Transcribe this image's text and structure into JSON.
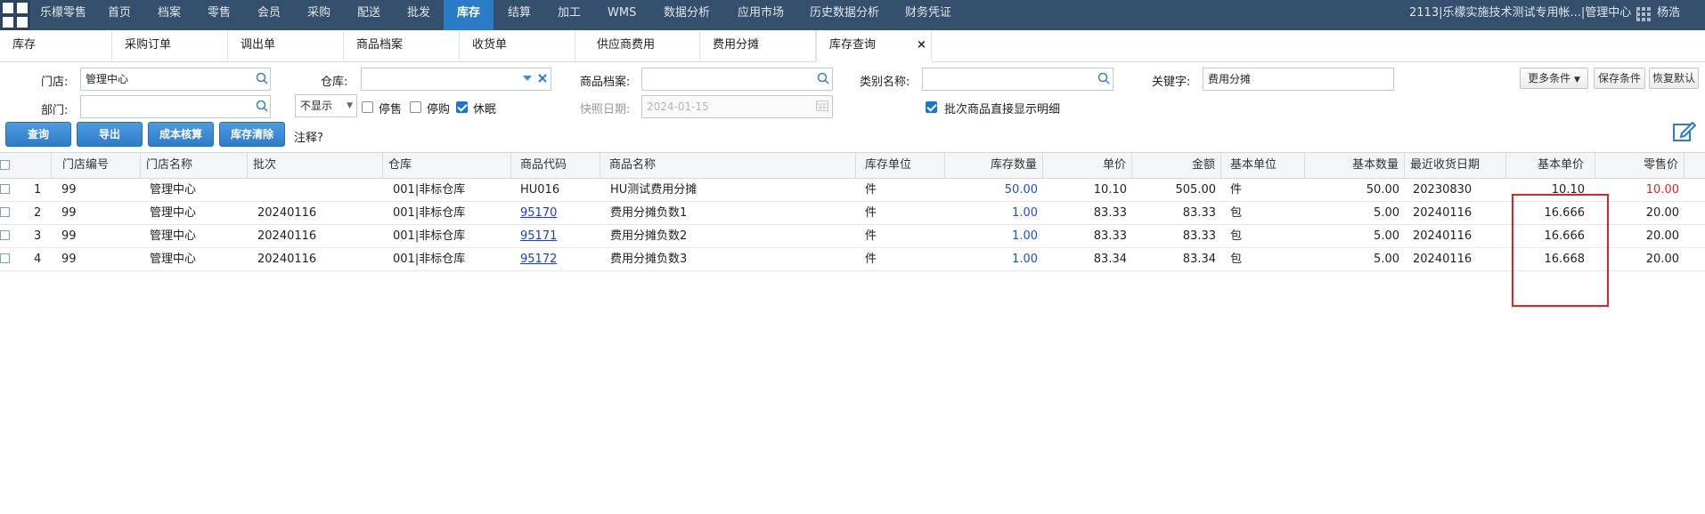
{
  "topnav": {
    "items": [
      {
        "label": "乐檬零售"
      },
      {
        "label": "首页"
      },
      {
        "label": "档案"
      },
      {
        "label": "零售"
      },
      {
        "label": "会员"
      },
      {
        "label": "采购"
      },
      {
        "label": "配送"
      },
      {
        "label": "批发"
      },
      {
        "label": "库存"
      },
      {
        "label": "结算"
      },
      {
        "label": "加工"
      },
      {
        "label": "WMS"
      },
      {
        "label": "数据分析"
      },
      {
        "label": "应用市场"
      },
      {
        "label": "历史数据分析"
      },
      {
        "label": "财务凭证"
      }
    ],
    "account": "2113|乐檬实施技术测试专用帐...|管理中心 |",
    "user": "杨浩"
  },
  "tabs": [
    {
      "label": "库存"
    },
    {
      "label": "采购订单"
    },
    {
      "label": "调出单"
    },
    {
      "label": "商品档案"
    },
    {
      "label": "收货单"
    },
    {
      "label": "供应商费用"
    },
    {
      "label": "费用分摊"
    },
    {
      "label": "库存查询"
    }
  ],
  "tab_close": "×",
  "form": {
    "store_label": "门店:",
    "store_value": "管理中心",
    "warehouse_label": "仓库:",
    "warehouse_value": "",
    "product_label": "商品档案:",
    "product_value": "",
    "category_label": "类别名称:",
    "category_value": "",
    "keyword_label": "关键字:",
    "keyword_value": "费用分摊",
    "dept_label": "部门:",
    "dept_value": "",
    "display_select": "不显示",
    "stop_sale": "停售",
    "stop_purchase": "停购",
    "dormant": "休眠",
    "snapshot_label": "快照日期:",
    "snapshot_value": "2024-01-15",
    "batch_detail": "批次商品直接显示明细",
    "note_label": "注释?"
  },
  "buttons": {
    "more": "更多条件",
    "save": "保存条件",
    "reset": "恢复默认",
    "query": "查询",
    "export": "导出",
    "cost_check": "成本核算",
    "clear": "库存清除"
  },
  "table": {
    "headers": [
      "门店编号",
      "门店名称",
      "批次",
      "仓库",
      "商品代码",
      "商品名称",
      "库存单位",
      "库存数量",
      "单价",
      "金额",
      "基本单位",
      "基本数量",
      "最近收货日期",
      "基本单价",
      "零售价"
    ],
    "rows": [
      {
        "no": "1",
        "store_no": "99",
        "store": "管理中心",
        "batch": "",
        "wh": "001|非标仓库",
        "code": "HU016",
        "name": "HU测试费用分摊",
        "unit": "件",
        "qty": "50.00",
        "price": "10.10",
        "amount": "505.00",
        "base_unit": "件",
        "base_qty": "50.00",
        "date": "20230830",
        "base_price": "10.10",
        "retail": "10.00"
      },
      {
        "no": "2",
        "store_no": "99",
        "store": "管理中心",
        "batch": "20240116",
        "wh": "001|非标仓库",
        "code": "95170",
        "name": "费用分摊负数1",
        "unit": "件",
        "qty": "1.00",
        "price": "83.33",
        "amount": "83.33",
        "base_unit": "包",
        "base_qty": "5.00",
        "date": "20240116",
        "base_price": "16.666",
        "retail": "20.00"
      },
      {
        "no": "3",
        "store_no": "99",
        "store": "管理中心",
        "batch": "20240116",
        "wh": "001|非标仓库",
        "code": "95171",
        "name": "费用分摊负数2",
        "unit": "件",
        "qty": "1.00",
        "price": "83.33",
        "amount": "83.33",
        "base_unit": "包",
        "base_qty": "5.00",
        "date": "20240116",
        "base_price": "16.666",
        "retail": "20.00"
      },
      {
        "no": "4",
        "store_no": "99",
        "store": "管理中心",
        "batch": "20240116",
        "wh": "001|非标仓库",
        "code": "95172",
        "name": "费用分摊负数3",
        "unit": "件",
        "qty": "1.00",
        "price": "83.34",
        "amount": "83.34",
        "base_unit": "包",
        "base_qty": "5.00",
        "date": "20240116",
        "base_price": "16.668",
        "retail": "20.00"
      }
    ]
  },
  "colors": {
    "nav_bg": "#34506c",
    "nav_active": "#2a7bc8",
    "primary_btn": "#2d7cc8",
    "highlight": "#e02424"
  }
}
